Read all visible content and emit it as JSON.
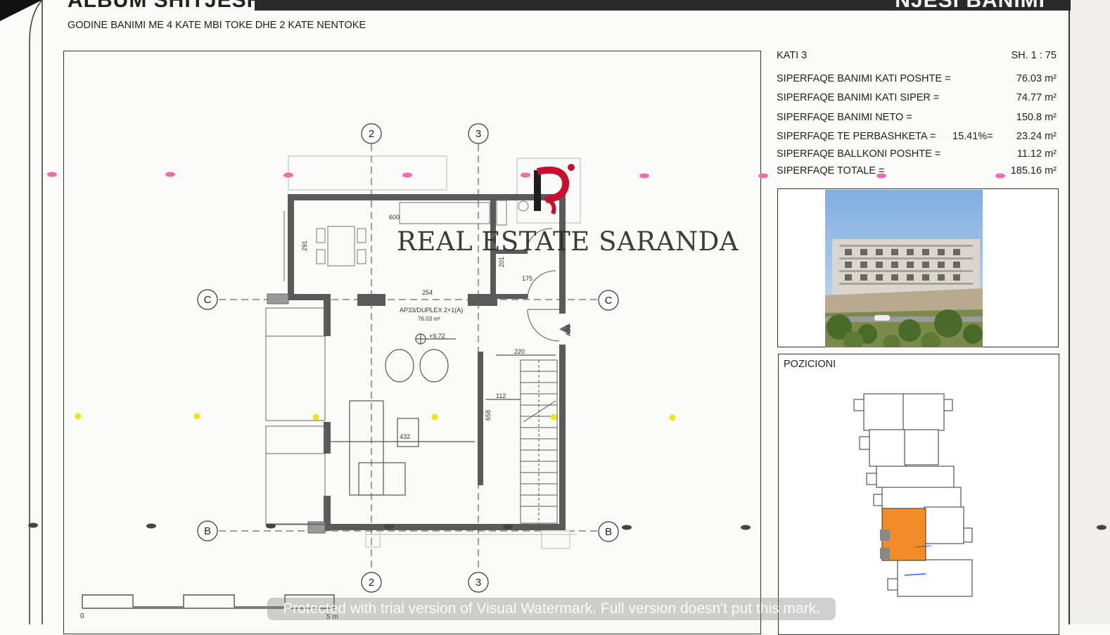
{
  "header": {
    "left_title": "ALBUM SHITJESH",
    "right_title": "NJESI BANIMI"
  },
  "subtitle": "GODINE BANIMI ME 4 KATE MBI TOKE DHE 2 KATE NENTOKE",
  "info": {
    "floor": "KATI 3",
    "scale": "SH. 1 : 75",
    "rows": [
      {
        "label": "SIPERFAQE BANIMI KATI POSHTE  =",
        "mid": "",
        "value": "76.03 m²"
      },
      {
        "label": "SIPERFAQE BANIMI KATI SIPER  =",
        "mid": "",
        "value": "74.77 m²"
      },
      {
        "label": "SIPERFAQE BANIMI NETO =",
        "mid": "",
        "value": "150.8 m²"
      },
      {
        "label": "SIPERFAQE TE PERBASHKETA =",
        "mid": "15.41%=",
        "value": "23.24 m²"
      },
      {
        "label": "SIPERFAQE BALLKONI POSHTE =",
        "mid": "",
        "value": "11.12 m²"
      },
      {
        "label": "SIPERFAQE TOTALE =",
        "mid": "",
        "value": "185.16 m²"
      }
    ]
  },
  "position_title": "POZICIONI",
  "plan": {
    "grid_top": [
      "2",
      "3"
    ],
    "grid_bottom": [
      "2",
      "3"
    ],
    "grid_left": [
      "C",
      "B"
    ],
    "grid_right": [
      "C",
      "B"
    ],
    "unit_name": "AP33/DUPLEX 2+1(A)",
    "unit_area": "76.03 m²",
    "level": "+9.72",
    "dims": {
      "d600": "600",
      "d291": "291",
      "d201": "201",
      "d175": "175",
      "d254": "254",
      "d220": "220",
      "d112": "112",
      "d658": "658",
      "d432": "432",
      "d333": "A33"
    },
    "scale_start": "0",
    "scale_end": "5 m"
  },
  "watermark": {
    "logo_letter": "P",
    "brand": "REAL ESTATE SARANDA",
    "trial": "Protected with trial version of Visual Watermark. Full version doesn't put this mark."
  },
  "colors": {
    "highlight": "#f28c28",
    "wall": "#555555",
    "dot_pink": "#f06bb0",
    "dot_yellow": "#f2e21b",
    "dot_gray": "#444444",
    "logo_red": "#c8102e"
  }
}
